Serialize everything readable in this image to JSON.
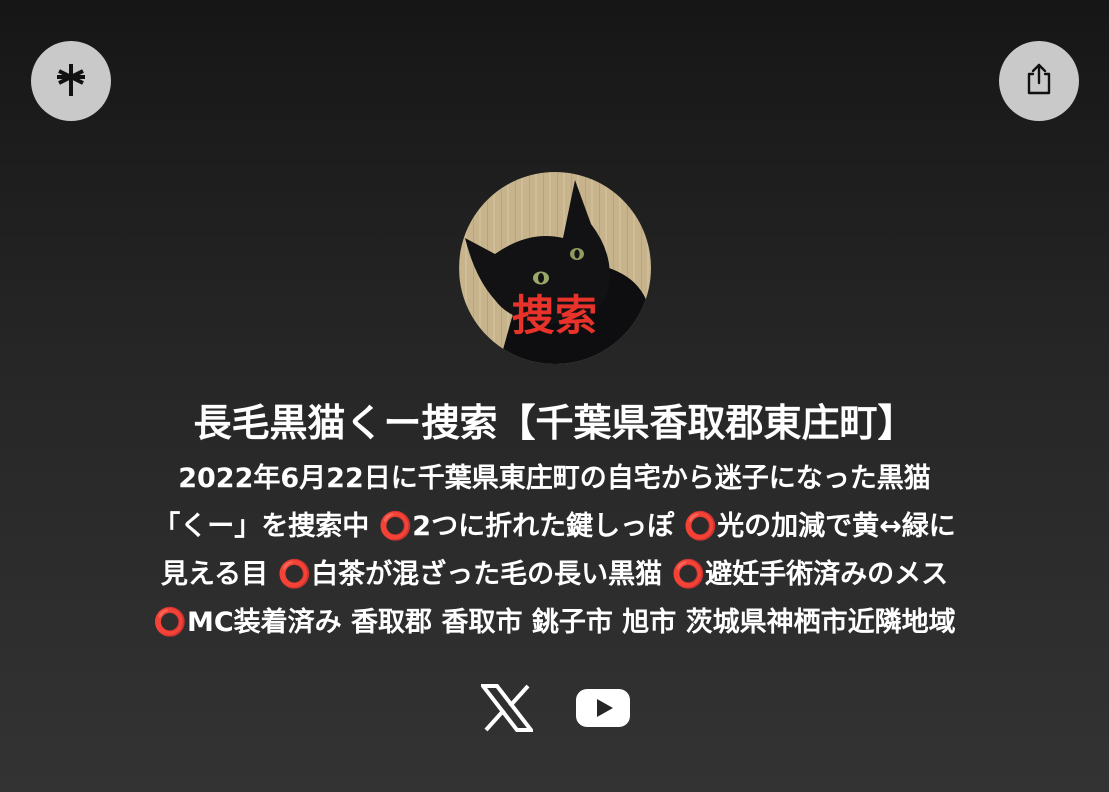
{
  "header": {
    "left_button_icon": "linktree-asterisk-icon",
    "right_button_icon": "share-icon"
  },
  "profile": {
    "avatar_label": "捜索",
    "title": "長毛黒猫くー捜索【千葉県香取郡東庄町】",
    "bio_lines": [
      "2022年6月22日に千葉県東庄町の自宅から迷子になった黒猫",
      "「くー」を捜索中 ⭕2つに折れた鍵しっぽ ⭕光の加減で黄↔緑に",
      "見える目 ⭕白茶が混ざった毛の長い黒猫 ⭕避妊手術済みのメス",
      "⭕MC装着済み 香取郡 香取市 銚子市 旭市 茨城県神栖市近隣地域"
    ]
  },
  "socials": [
    {
      "name": "x-icon"
    },
    {
      "name": "youtube-icon"
    }
  ],
  "colors": {
    "button_bg": "#c9c9c9",
    "avatar_label": "#e8322a",
    "circle_mark": "#e0201c"
  }
}
